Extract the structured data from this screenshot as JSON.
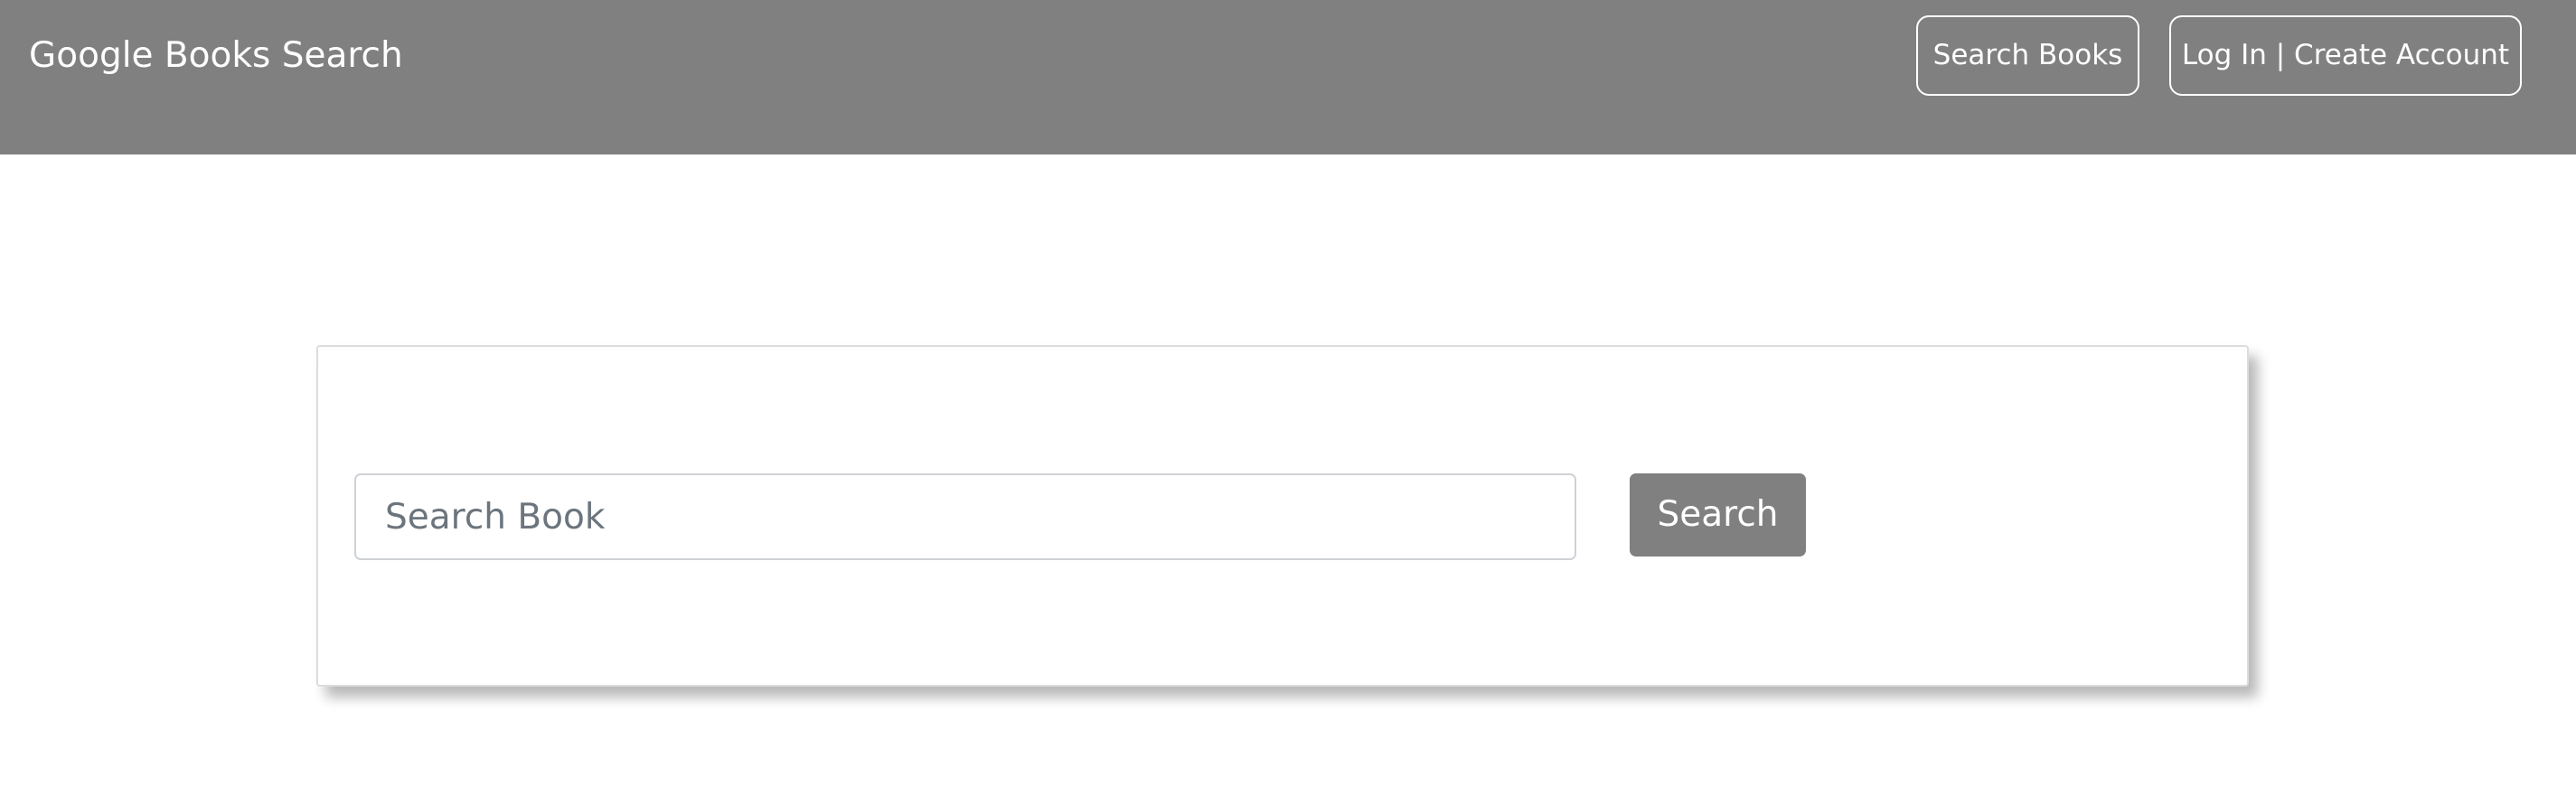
{
  "navbar": {
    "brand": "Google Books Search",
    "search_books_label": "Search Books",
    "login_label": "Log In | Create Account",
    "background_color": "#808080"
  },
  "search": {
    "placeholder": "Search Book",
    "value": "",
    "button_label": "Search",
    "button_color": "#808080"
  }
}
